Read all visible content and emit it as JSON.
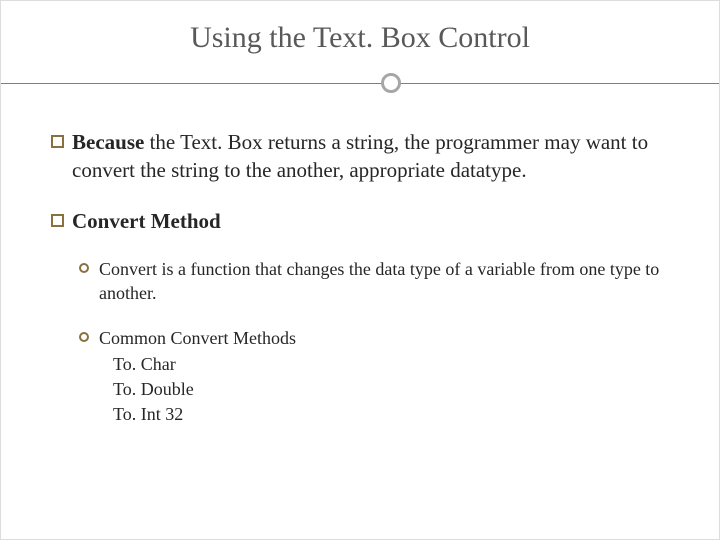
{
  "title": "Using the Text. Box Control",
  "bullets": [
    {
      "lead": "Because",
      "rest": " the Text. Box returns a string, the programmer may want to convert the string to the another, appropriate datatype."
    },
    {
      "lead": "Convert Method",
      "rest": ""
    }
  ],
  "subbullets": [
    "Convert is a function that changes the data type of a variable from one type to another.",
    "Common Convert Methods"
  ],
  "methods": [
    "To. Char",
    "To. Double",
    "To. Int 32"
  ]
}
